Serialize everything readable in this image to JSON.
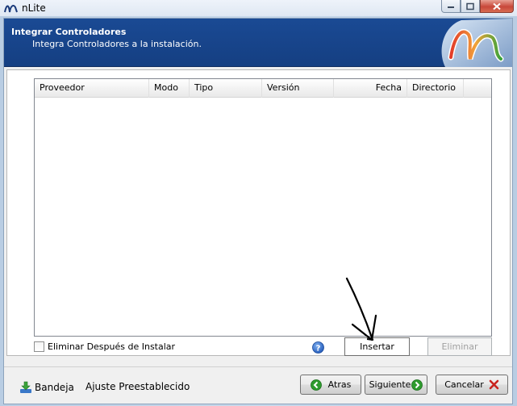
{
  "window": {
    "title": "nLite",
    "icons": {
      "app": "nlite-logo-icon",
      "minimize": "minimize-icon",
      "maximize": "maximize-icon",
      "close": "close-icon"
    }
  },
  "header": {
    "title": "Integrar Controladores",
    "subtitle": "Integra Controladores a la instalación.",
    "logo_icon": "nlite-logo-icon"
  },
  "list": {
    "columns": [
      "Proveedor",
      "Modo",
      "Tipo",
      "Versión",
      "Fecha",
      "Directorio"
    ],
    "rows": []
  },
  "options": {
    "remove_after_install_label": "Eliminar Después de Instalar",
    "remove_after_install_checked": false,
    "help_icon": "help-icon"
  },
  "actions": {
    "insert_label": "Insertar",
    "delete_label": "Eliminar"
  },
  "footer": {
    "tray_label": "Bandeja",
    "tray_icon": "download-tray-icon",
    "preset_label": "Ajuste Preestablecido",
    "back_label": "Atras",
    "next_label": "Siguiente",
    "cancel_label": "Cancelar"
  },
  "colors": {
    "header_bg": "#1a4a94",
    "nav_green": "#2e9b2e",
    "cancel_red": "#c8231e"
  }
}
